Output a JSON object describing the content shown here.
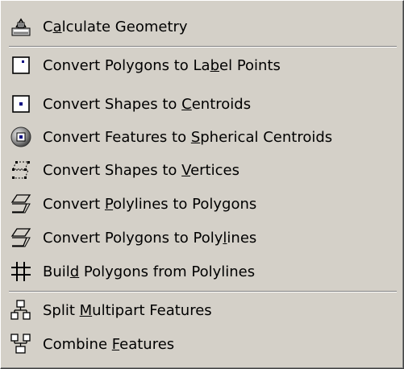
{
  "menu": {
    "items": [
      {
        "id": "calculate-geometry",
        "icon": "calculator-icon",
        "prefix": "C",
        "mnemonic": "a",
        "suffix": "lculate Geometry"
      },
      {
        "id": "convert-polygons-to-label-points",
        "icon": "label-point-icon",
        "prefix": "Convert Polygons to La",
        "mnemonic": "b",
        "suffix": "el Points"
      },
      {
        "id": "convert-shapes-to-centroids",
        "icon": "centroid-icon",
        "prefix": "Convert Shapes to ",
        "mnemonic": "C",
        "suffix": "entroids"
      },
      {
        "id": "convert-features-to-spherical-centroids",
        "icon": "sphere-centroid-icon",
        "prefix": "Convert Features to ",
        "mnemonic": "S",
        "suffix": "pherical Centroids"
      },
      {
        "id": "convert-shapes-to-vertices",
        "icon": "vertices-icon",
        "prefix": "Convert Shapes to ",
        "mnemonic": "V",
        "suffix": "ertices"
      },
      {
        "id": "convert-polylines-to-polygons",
        "icon": "polyline-to-polygon-icon",
        "prefix": "Convert ",
        "mnemonic": "P",
        "suffix": "olylines to Polygons"
      },
      {
        "id": "convert-polygons-to-polylines",
        "icon": "polygon-to-polyline-icon",
        "prefix": "Convert Polygons to Poly",
        "mnemonic": "l",
        "suffix": "ines"
      },
      {
        "id": "build-polygons-from-polylines",
        "icon": "hash-grid-icon",
        "prefix": "Buil",
        "mnemonic": "d",
        "suffix": " Polygons from Polylines"
      },
      {
        "id": "split-multipart-features",
        "icon": "split-features-icon",
        "prefix": "Split ",
        "mnemonic": "M",
        "suffix": "ultipart Features"
      },
      {
        "id": "combine-features",
        "icon": "combine-features-icon",
        "prefix": "Combine ",
        "mnemonic": "F",
        "suffix": "eatures"
      }
    ]
  }
}
